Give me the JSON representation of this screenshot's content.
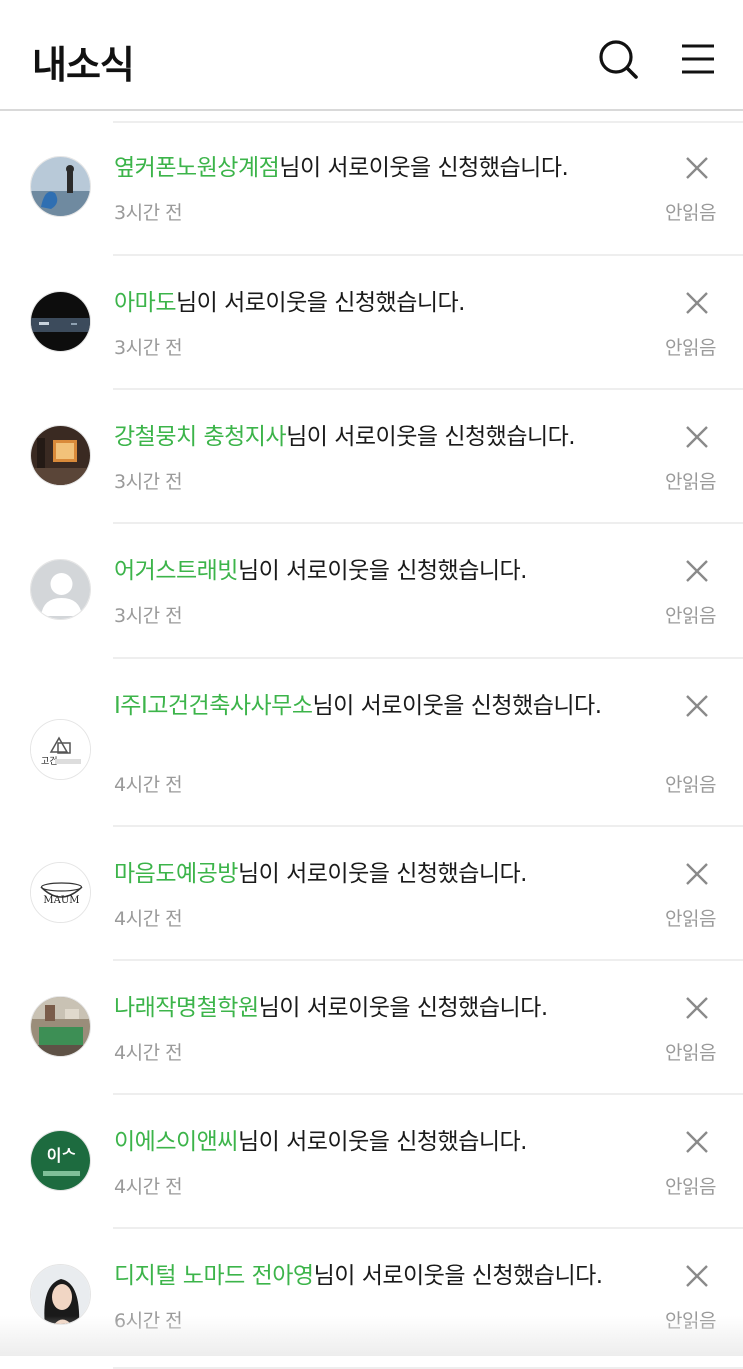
{
  "header": {
    "title": "내소식"
  },
  "notifications": [
    {
      "name": "옆커폰노원상계점",
      "suffix": "님이 서로이웃을 신청했습니다.",
      "time": "3시간 전",
      "status": "안읽음",
      "avatar": "photo-sculpture"
    },
    {
      "name": "아마도",
      "suffix": "님이 서로이웃을 신청했습니다.",
      "time": "3시간 전",
      "status": "안읽음",
      "avatar": "photo-dark-night"
    },
    {
      "name": "강철뭉치 충청지사",
      "suffix": "님이 서로이웃을 신청했습니다.",
      "time": "3시간 전",
      "status": "안읽음",
      "avatar": "photo-room"
    },
    {
      "name": "어거스트래빗",
      "suffix": "님이 서로이웃을 신청했습니다.",
      "time": "3시간 전",
      "status": "안읽음",
      "avatar": "default-person"
    },
    {
      "name": "I주I고건건축사사무소",
      "suffix": "님이 서로이웃을 신청했습니다.",
      "time": "4시간 전",
      "status": "안읽음",
      "avatar": "logo-gogun",
      "logo_text": "고건"
    },
    {
      "name": "마음도예공방",
      "suffix": "님이 서로이웃을 신청했습니다.",
      "time": "4시간 전",
      "status": "안읽음",
      "avatar": "logo-maum",
      "logo_text": "MAUM"
    },
    {
      "name": "나래작명철학원",
      "suffix": "님이 서로이웃을 신청했습니다.",
      "time": "4시간 전",
      "status": "안읽음",
      "avatar": "photo-office"
    },
    {
      "name": "이에스이앤씨",
      "suffix": "님이 서로이웃을 신청했습니다.",
      "time": "4시간 전",
      "status": "안읽음",
      "avatar": "logo-esi"
    },
    {
      "name": "디지털 노마드 전아영",
      "suffix": "님이 서로이웃을 신청했습니다.",
      "time": "6시간 전",
      "status": "안읽음",
      "avatar": "photo-portrait"
    }
  ],
  "colors": {
    "name_accent": "#3cb44a",
    "muted": "#9a9a9a",
    "divider": "#eeeeee"
  }
}
